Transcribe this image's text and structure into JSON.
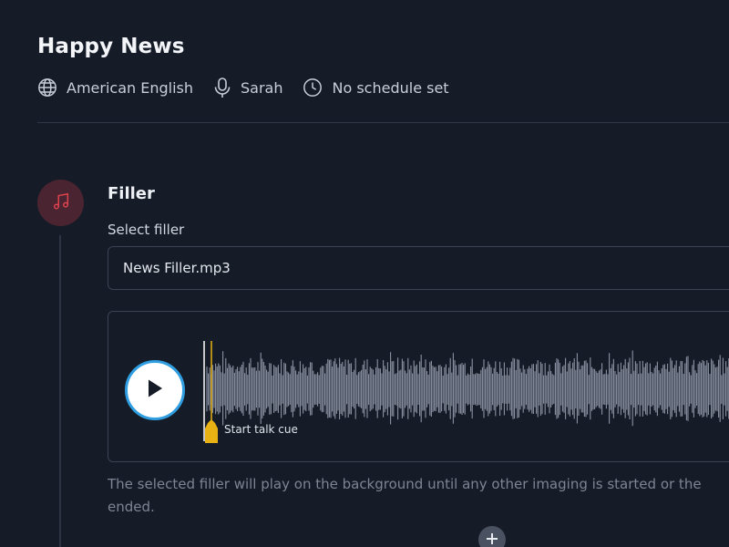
{
  "header": {
    "title": "Happy News",
    "language": "American English",
    "voice": "Sarah",
    "schedule": "No schedule set"
  },
  "step": {
    "icon": "music-note-icon",
    "title": "Filler",
    "select_label": "Select filler",
    "selected_file": "News Filler.mp3"
  },
  "player": {
    "cue_label": "Start talk cue",
    "helper_text": "The selected filler will play on the background until any other imaging is started or the ended."
  },
  "colors": {
    "background": "#151b27",
    "accent_cue": "#e8b214",
    "play_ring": "#2f9ee0",
    "step_circle": "#4a2430",
    "music_icon": "#e0434f"
  }
}
